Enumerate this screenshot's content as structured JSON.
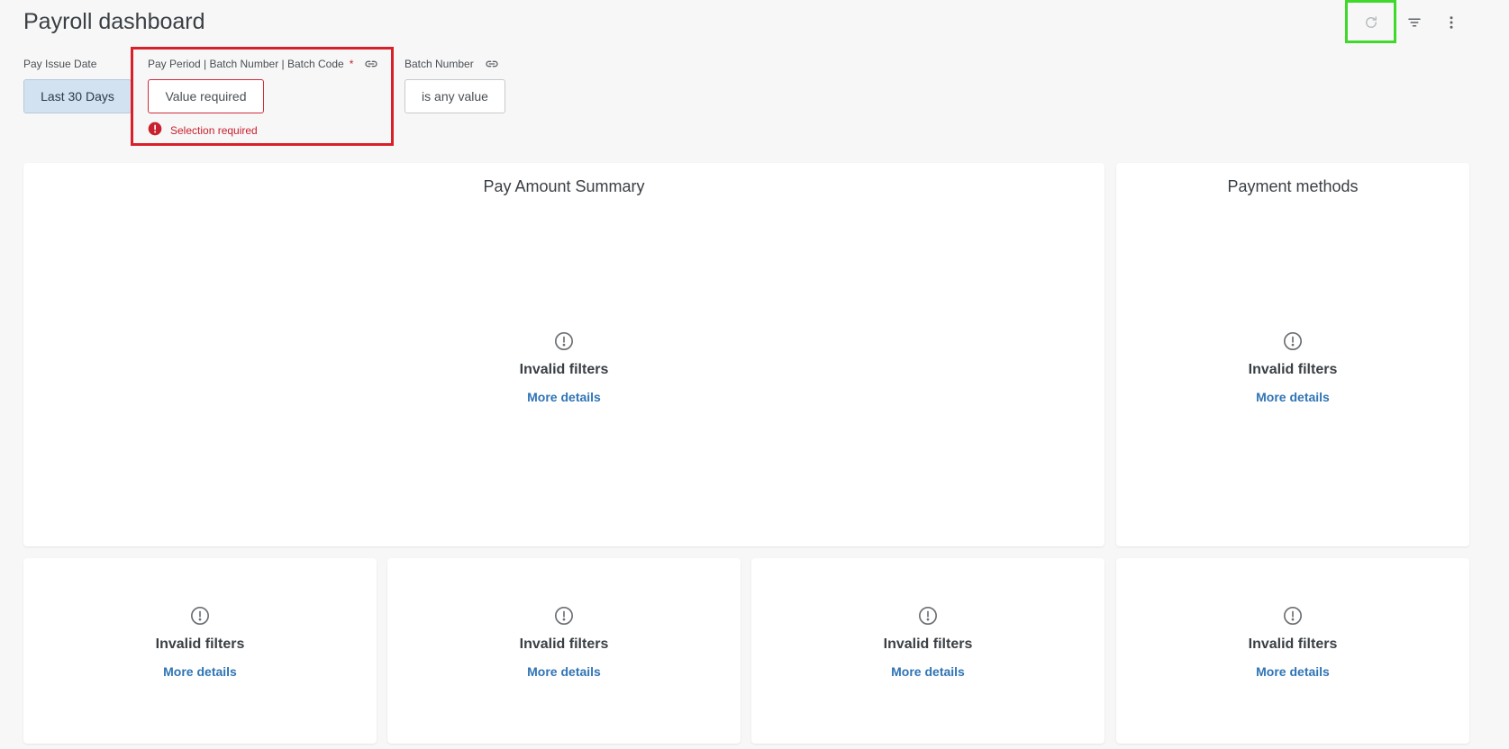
{
  "header": {
    "title": "Payroll dashboard"
  },
  "toolbar": {
    "reload_icon": "reload-icon",
    "filter_icon": "filter-icon",
    "more_icon": "more-vertical-icon"
  },
  "filters": [
    {
      "label": "Pay Issue Date",
      "value": "Last 30 Days"
    },
    {
      "label": "Pay Period | Batch Number | Batch Code",
      "required_mark": "*",
      "value": "Value required",
      "error": "Selection required"
    },
    {
      "label": "Batch Number",
      "value": "is any value"
    }
  ],
  "tiles": {
    "pay_amount_summary": {
      "title": "Pay Amount Summary",
      "message": "Invalid filters",
      "link": "More details"
    },
    "payment_methods": {
      "title": "Payment methods",
      "message": "Invalid filters",
      "link": "More details"
    },
    "tile_3": {
      "message": "Invalid filters",
      "link": "More details"
    },
    "tile_4": {
      "message": "Invalid filters",
      "link": "More details"
    },
    "tile_5": {
      "message": "Invalid filters",
      "link": "More details"
    },
    "tile_6": {
      "message": "Invalid filters",
      "link": "More details"
    }
  },
  "colors": {
    "error_red": "#c8202f",
    "link_blue": "#2f74b5",
    "chip_selected_bg": "#d3e2f0",
    "highlight_green": "#3fd82b",
    "highlight_red": "#d8202a"
  }
}
